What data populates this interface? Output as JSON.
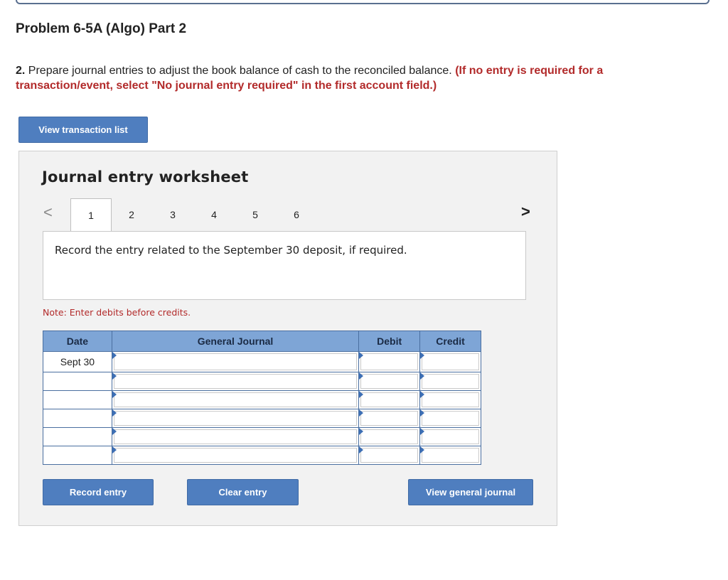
{
  "page": {
    "title": "Problem 6-5A (Algo) Part 2",
    "instruction_number": "2.",
    "instruction_text": "Prepare journal entries to adjust the book balance of cash to the reconciled balance.",
    "instruction_note": "(If no entry is required for a transaction/event, select \"No journal entry required\" in the first account field.)"
  },
  "buttons": {
    "view_transaction_list": "View transaction list",
    "record_entry": "Record entry",
    "clear_entry": "Clear entry",
    "view_general_journal": "View general journal"
  },
  "worksheet": {
    "title": "Journal entry worksheet",
    "nav_prev": "<",
    "nav_next": ">",
    "tabs": [
      "1",
      "2",
      "3",
      "4",
      "5",
      "6"
    ],
    "active_tab": "1",
    "description": "Record the entry related to the September 30 deposit, if required.",
    "note": "Note: Enter debits before credits."
  },
  "journal": {
    "headers": {
      "date": "Date",
      "account": "General Journal",
      "debit": "Debit",
      "credit": "Credit"
    },
    "rows": [
      {
        "date": "Sept 30"
      },
      {
        "date": ""
      },
      {
        "date": ""
      },
      {
        "date": ""
      },
      {
        "date": ""
      },
      {
        "date": ""
      }
    ]
  },
  "colors": {
    "button_blue": "#4f7ebf",
    "header_blue": "#7ea5d6",
    "instruction_red": "#b22a2a"
  }
}
